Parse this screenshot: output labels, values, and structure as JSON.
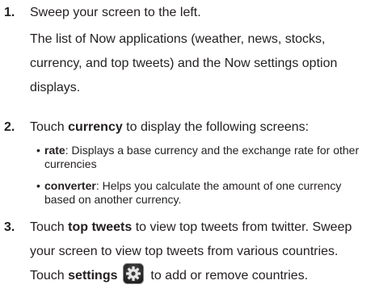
{
  "steps": [
    {
      "number": "1.",
      "line1": "Sweep your screen to the left.",
      "line2": "The list of Now applications (weather, news, stocks, currency, and top tweets) and the Now settings option displays."
    },
    {
      "number": "2.",
      "pre": "Touch ",
      "bold": "currency",
      "post": " to display the following screens:",
      "bullets": [
        {
          "term": "rate",
          "text": ": Displays a base currency and the exchange rate for other currencies"
        },
        {
          "term": "converter",
          "text": ": Helps you calculate the amount of one currency based on another currency."
        }
      ]
    },
    {
      "number": "3.",
      "pre": "Touch ",
      "bold": "top tweets",
      "post": " to view top tweets from twitter. Sweep your screen to view top tweets from various countries.",
      "line2_pre": "Touch ",
      "line2_bold": "settings",
      "line2_post": " to add or remove countries.",
      "icon": "settings-gear-icon"
    }
  ]
}
